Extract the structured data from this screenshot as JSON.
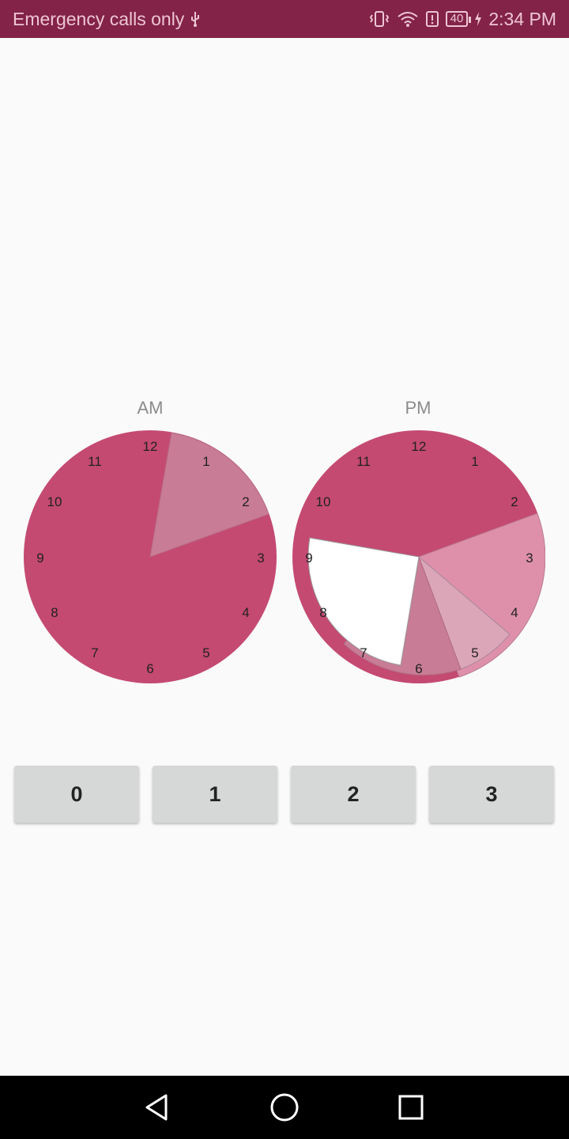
{
  "status_bar": {
    "carrier_text": "Emergency calls only",
    "time": "2:34 PM",
    "battery_level": "40",
    "icons": [
      "usb-icon",
      "vibrate-icon",
      "wifi-icon",
      "alert-icon",
      "battery-icon",
      "charging-icon"
    ]
  },
  "clocks": {
    "am": {
      "label": "AM",
      "hours": [
        "12",
        "1",
        "2",
        "3",
        "4",
        "5",
        "6",
        "7",
        "8",
        "9",
        "10",
        "11"
      ]
    },
    "pm": {
      "label": "PM",
      "hours": [
        "12",
        "1",
        "2",
        "3",
        "4",
        "5",
        "6",
        "7",
        "8",
        "9",
        "10",
        "11"
      ]
    }
  },
  "buttons": [
    "0",
    "1",
    "2",
    "3"
  ],
  "nav": {
    "icons": [
      "back-icon",
      "home-icon",
      "recents-icon"
    ]
  },
  "colors": {
    "status_bar": "#822347",
    "primary": "#c44a72",
    "light": "#c97c95",
    "lighter": "#de90aa",
    "lightest": "#dba6b8",
    "white_segment": "#ffffff"
  }
}
